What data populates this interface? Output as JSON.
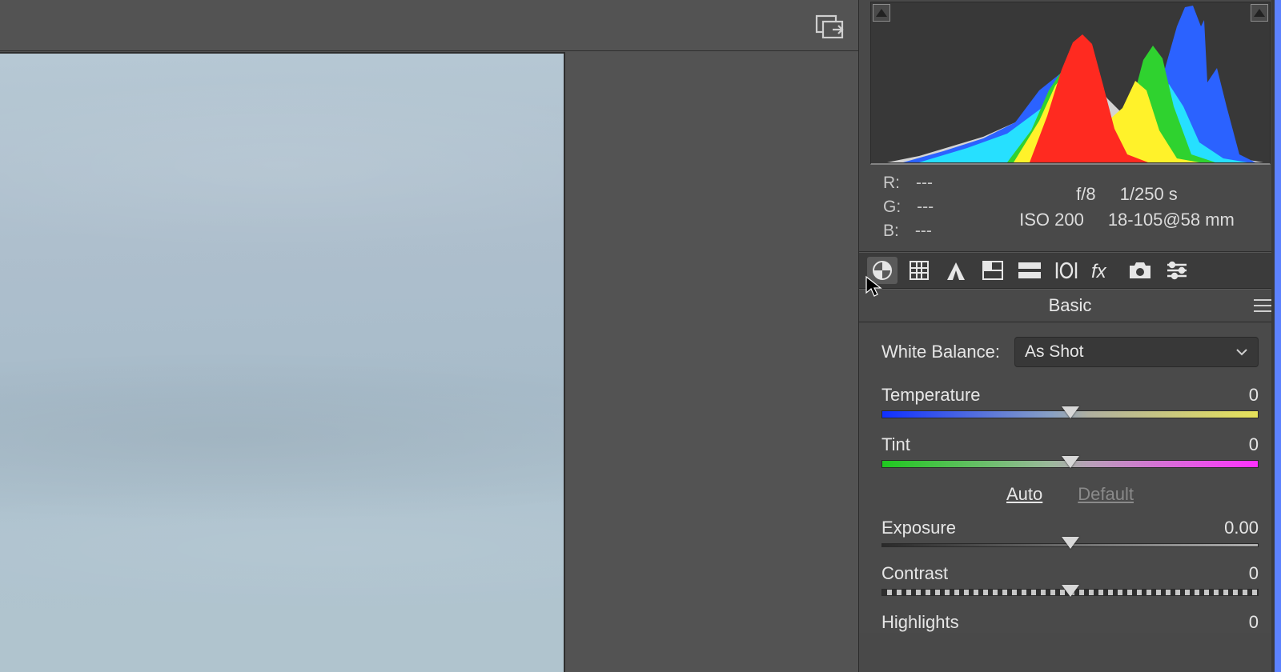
{
  "rgb": {
    "r_label": "R:",
    "g_label": "G:",
    "b_label": "B:",
    "r_val": "---",
    "g_val": "---",
    "b_val": "---"
  },
  "exif": {
    "aperture": "f/8",
    "shutter": "1/250 s",
    "iso": "ISO 200",
    "lens": "18-105@58 mm"
  },
  "section": {
    "title": "Basic"
  },
  "wb": {
    "label": "White Balance:",
    "selected": "As Shot"
  },
  "sliders": {
    "temperature": {
      "label": "Temperature",
      "value": "0"
    },
    "tint": {
      "label": "Tint",
      "value": "0"
    },
    "exposure": {
      "label": "Exposure",
      "value": "0.00"
    },
    "contrast": {
      "label": "Contrast",
      "value": "0"
    },
    "highlights": {
      "label": "Highlights",
      "value": "0"
    }
  },
  "links": {
    "auto": "Auto",
    "default": "Default"
  },
  "tabs": [
    "basic",
    "tone-curve",
    "detail",
    "hsl",
    "split-tone",
    "lens",
    "fx",
    "camera",
    "presets"
  ]
}
